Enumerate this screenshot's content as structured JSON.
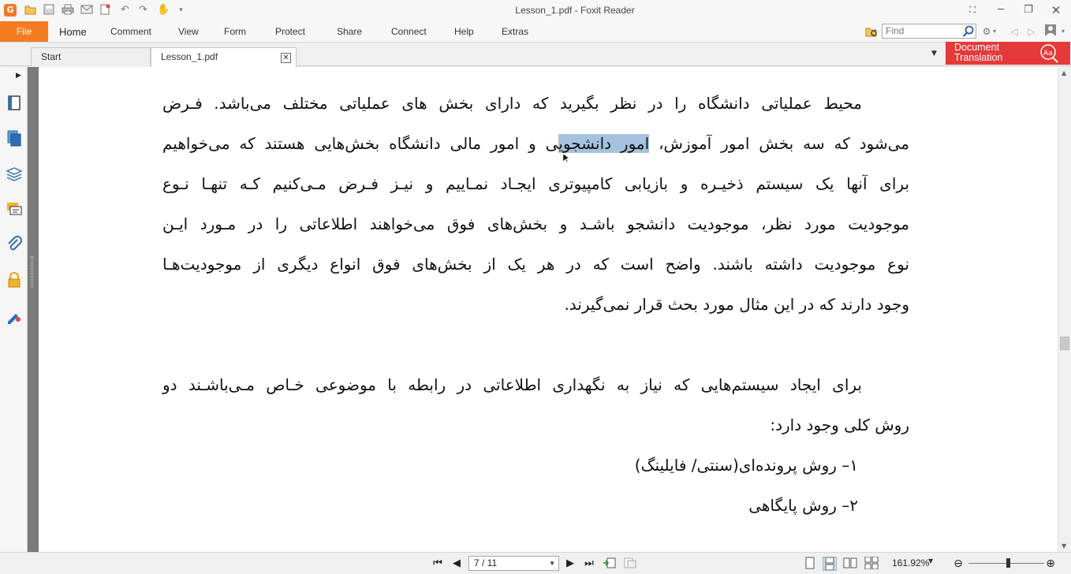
{
  "window": {
    "title": "Lesson_1.pdf - Foxit Reader",
    "app_logo_letter": "G"
  },
  "quick_access": [
    "open-icon",
    "save-icon",
    "print-icon",
    "email-icon",
    "new-icon",
    "undo-icon",
    "redo-icon",
    "hand-tool-icon",
    "customize-icon"
  ],
  "ribbon": {
    "file_label": "File",
    "tabs": [
      "Home",
      "Comment",
      "View",
      "Form",
      "Protect",
      "Share",
      "Connect",
      "Help",
      "Extras"
    ],
    "active_tab": "Home",
    "find_placeholder": "Find"
  },
  "tabs": {
    "items": [
      "Start",
      "Lesson_1.pdf"
    ],
    "active": "Lesson_1.pdf"
  },
  "doc_translation": {
    "label": "Document\nTranslation"
  },
  "nav_pane_icons": [
    "bookmarks-icon",
    "pages-icon",
    "layers-icon",
    "comments-icon",
    "attachments-icon",
    "security-icon",
    "signatures-icon"
  ],
  "document": {
    "paragraph1": [
      "محیط عملیاتی دانشگاه را در نظر بگیرید که دارای بخش های عملیاتی مختلف می‌باشد. فـرض",
      "نوع موجودیت داشته باشند. واضح است که در هر یک از بخش‌های فوق انواع دیگری از موجودیت‌هـا",
      "وجود دارند که در این مثال مورد بحث قرار نمی‌گیرند."
    ],
    "line2_before": "می‌شود که سه بخش امور آموزش، ",
    "line2_highlight": "امور دانشجوی",
    "line2_after": "ی و امور مالی دانشگاه بخش‌هایی هستند که می‌خواهیم",
    "line3": "برای آنها یک سیستم ذخیـره و بازیابی کامپیوتری ایجـاد نمـاییم و نیـز فـرض مـی‌کنیم کـه تنهـا نـوع",
    "line4": "موجودیت مورد نظر، موجودیت دانشجو باشـد و بخش‌های فوق می‌خواهند اطلاعاتی را در مـورد ایـن",
    "paragraph2_line1": "برای ایجاد سیستم‌هایی که نیاز به نگهداری اطلاعاتی در رابطه با موضوعی خـاص مـی‌باشـند دو",
    "paragraph2_line2": "روش کلی وجود دارد:",
    "list_item1": "۱– روش پرونده‌ای(سنتی/ فایلینگ)",
    "list_item2": "۲– روش پایگاهی"
  },
  "statusbar": {
    "page_indicator": "7 / 11",
    "zoom": "161.92%",
    "zoom_fraction": 0.5
  },
  "colors": {
    "file_tab": "#f47b20",
    "translation_button": "#e5393a",
    "selection_highlight": "#a5c3e0"
  }
}
